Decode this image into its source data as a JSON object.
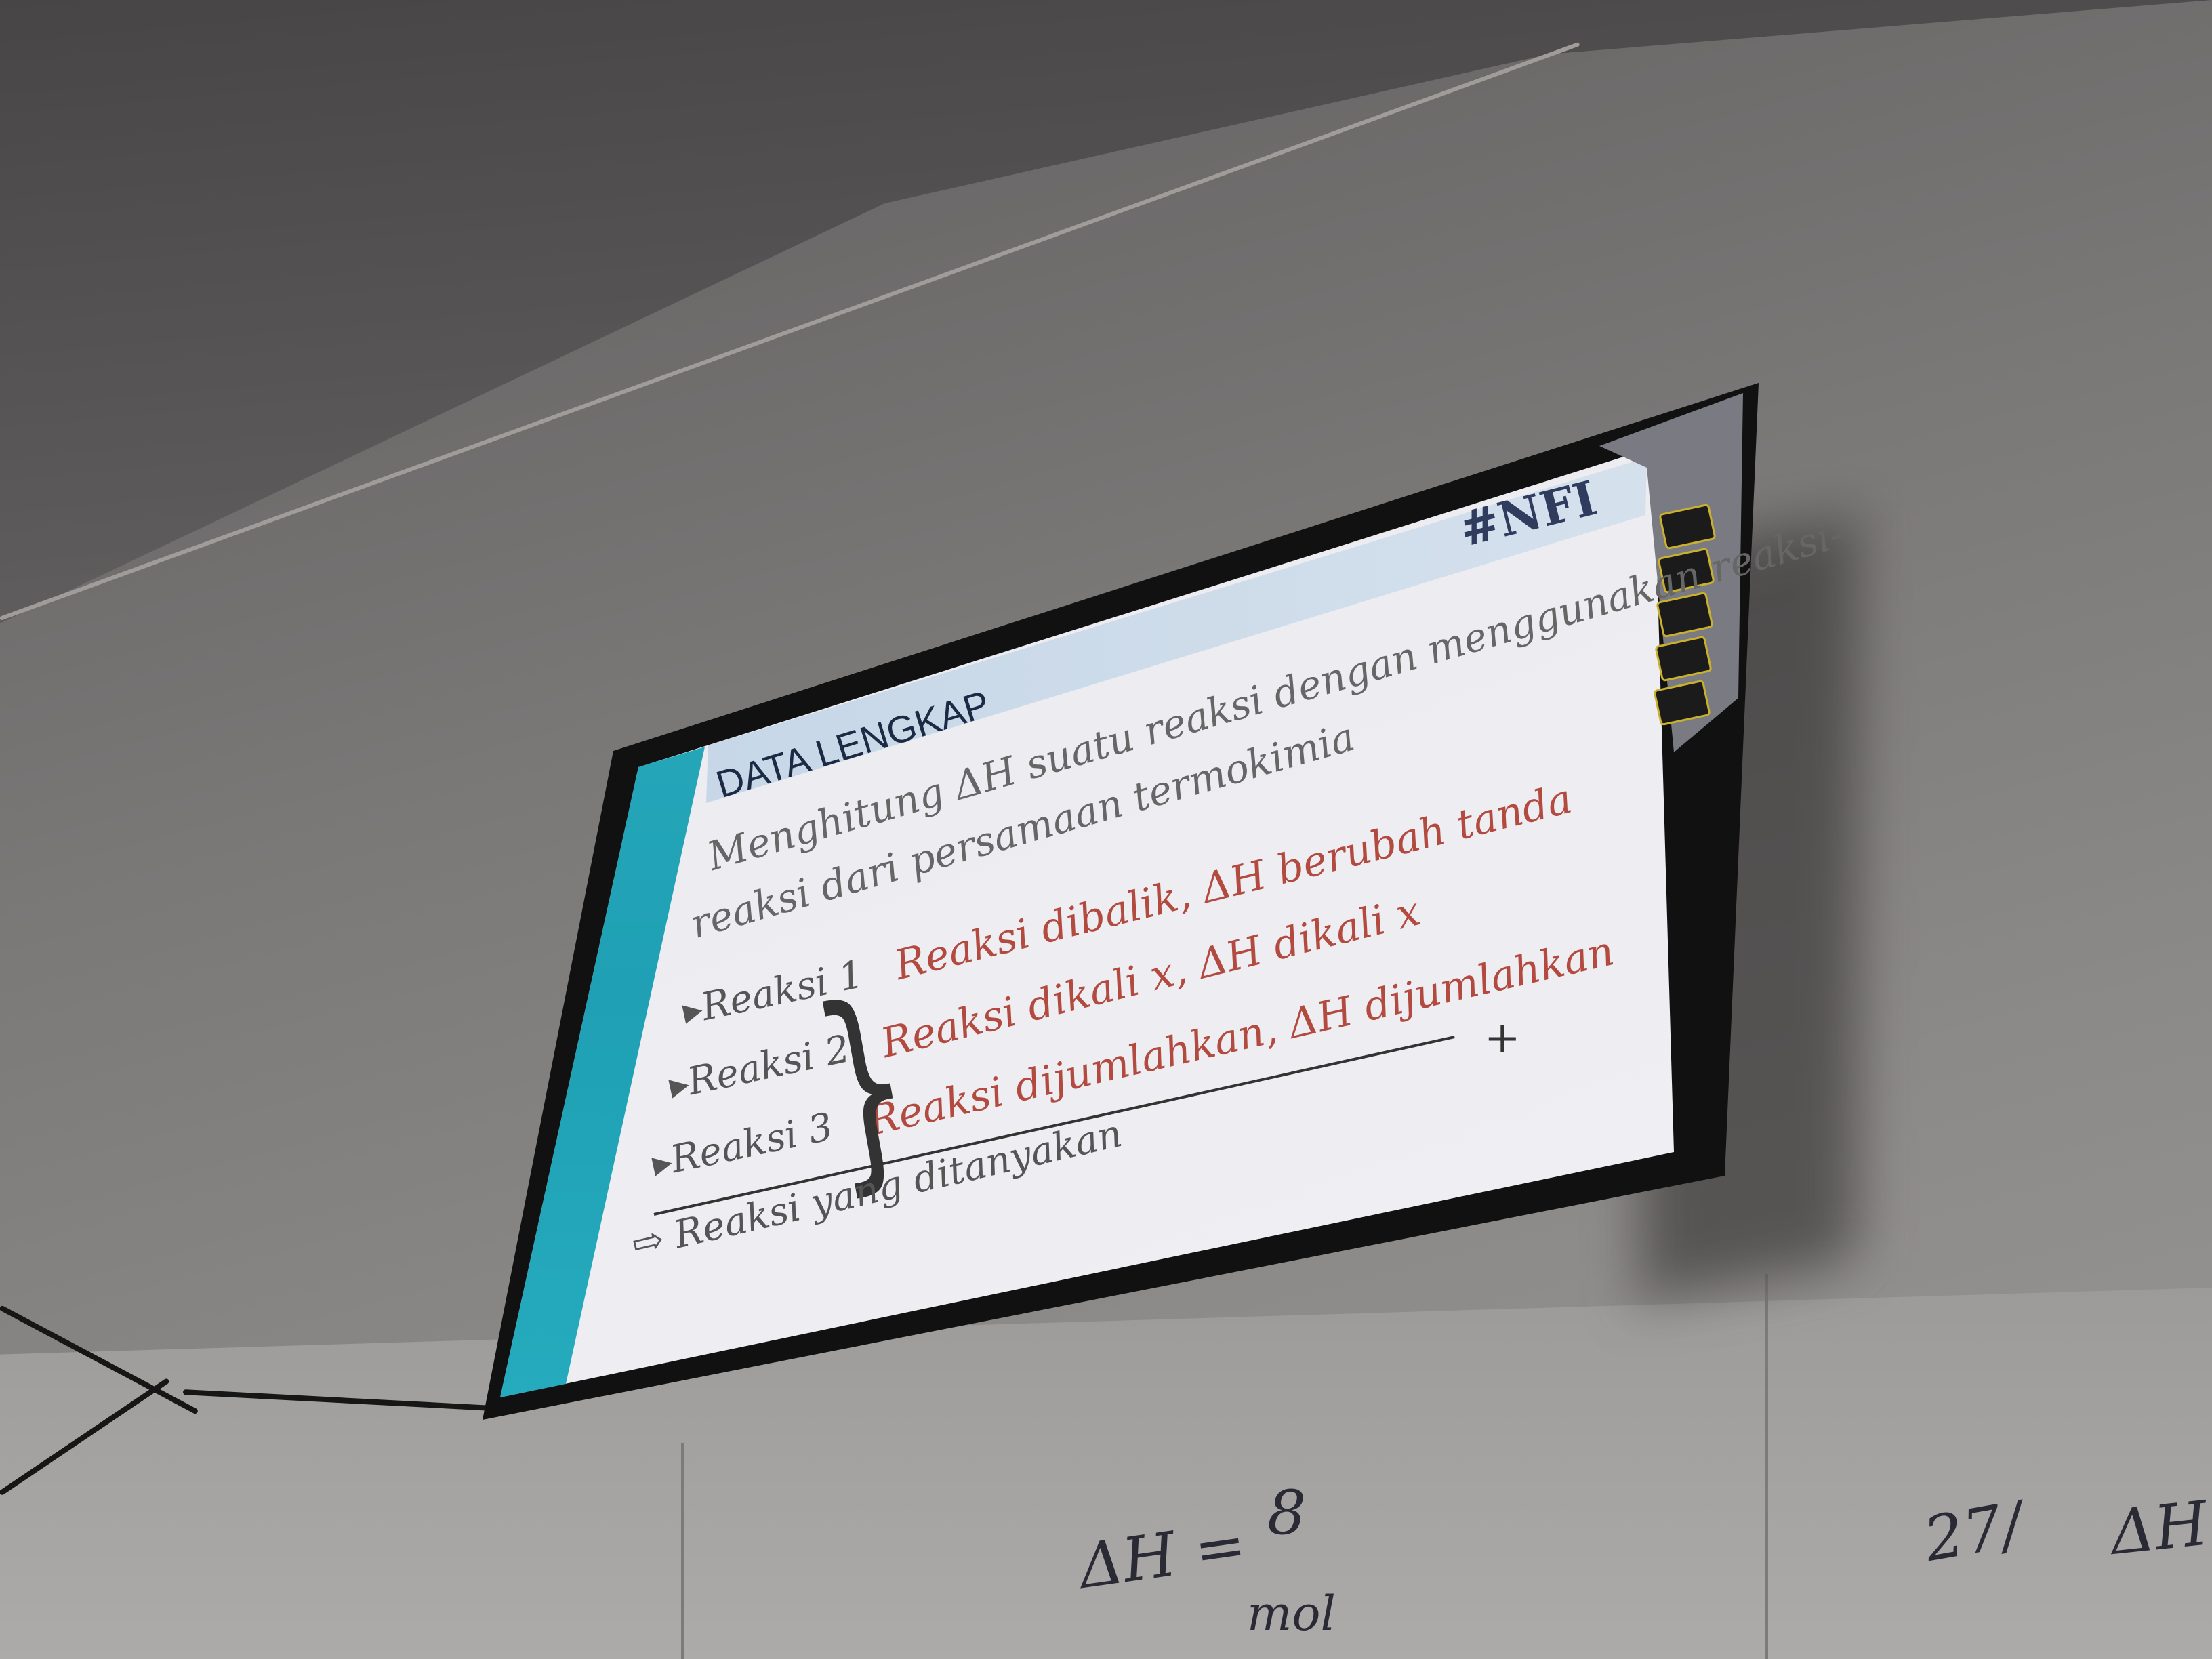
{
  "slide": {
    "hashtag": "#NFI",
    "title": "DATA LENGKAP",
    "intro_line1": "Menghitung ΔH suatu reaksi dengan menggunakan reaksi-",
    "intro_line2": "reaksi dari persamaan termokimia",
    "reactions": [
      "▸Reaksi 1",
      "▸Reaksi 2",
      "▸Reaksi 3"
    ],
    "rules": [
      "Reaksi dibalik, ΔH berubah tanda",
      "Reaksi dikali x, ΔH dikali x",
      "Reaksi dijumlahkan, ΔH dijumlahkan"
    ],
    "plus_sign": "+",
    "result": "⇨ Reaksi yang ditanyakan"
  },
  "whiteboard": {
    "expr1": "ΔH =",
    "frac_num": "8",
    "frac_den": "mol",
    "mark": "27/",
    "expr2": "ΔH"
  },
  "colors": {
    "slide_background": "#ececf1",
    "slide_sidebar": "#2ab2c4",
    "rule_text": "#b34a40",
    "title_text": "#1d2a44"
  }
}
